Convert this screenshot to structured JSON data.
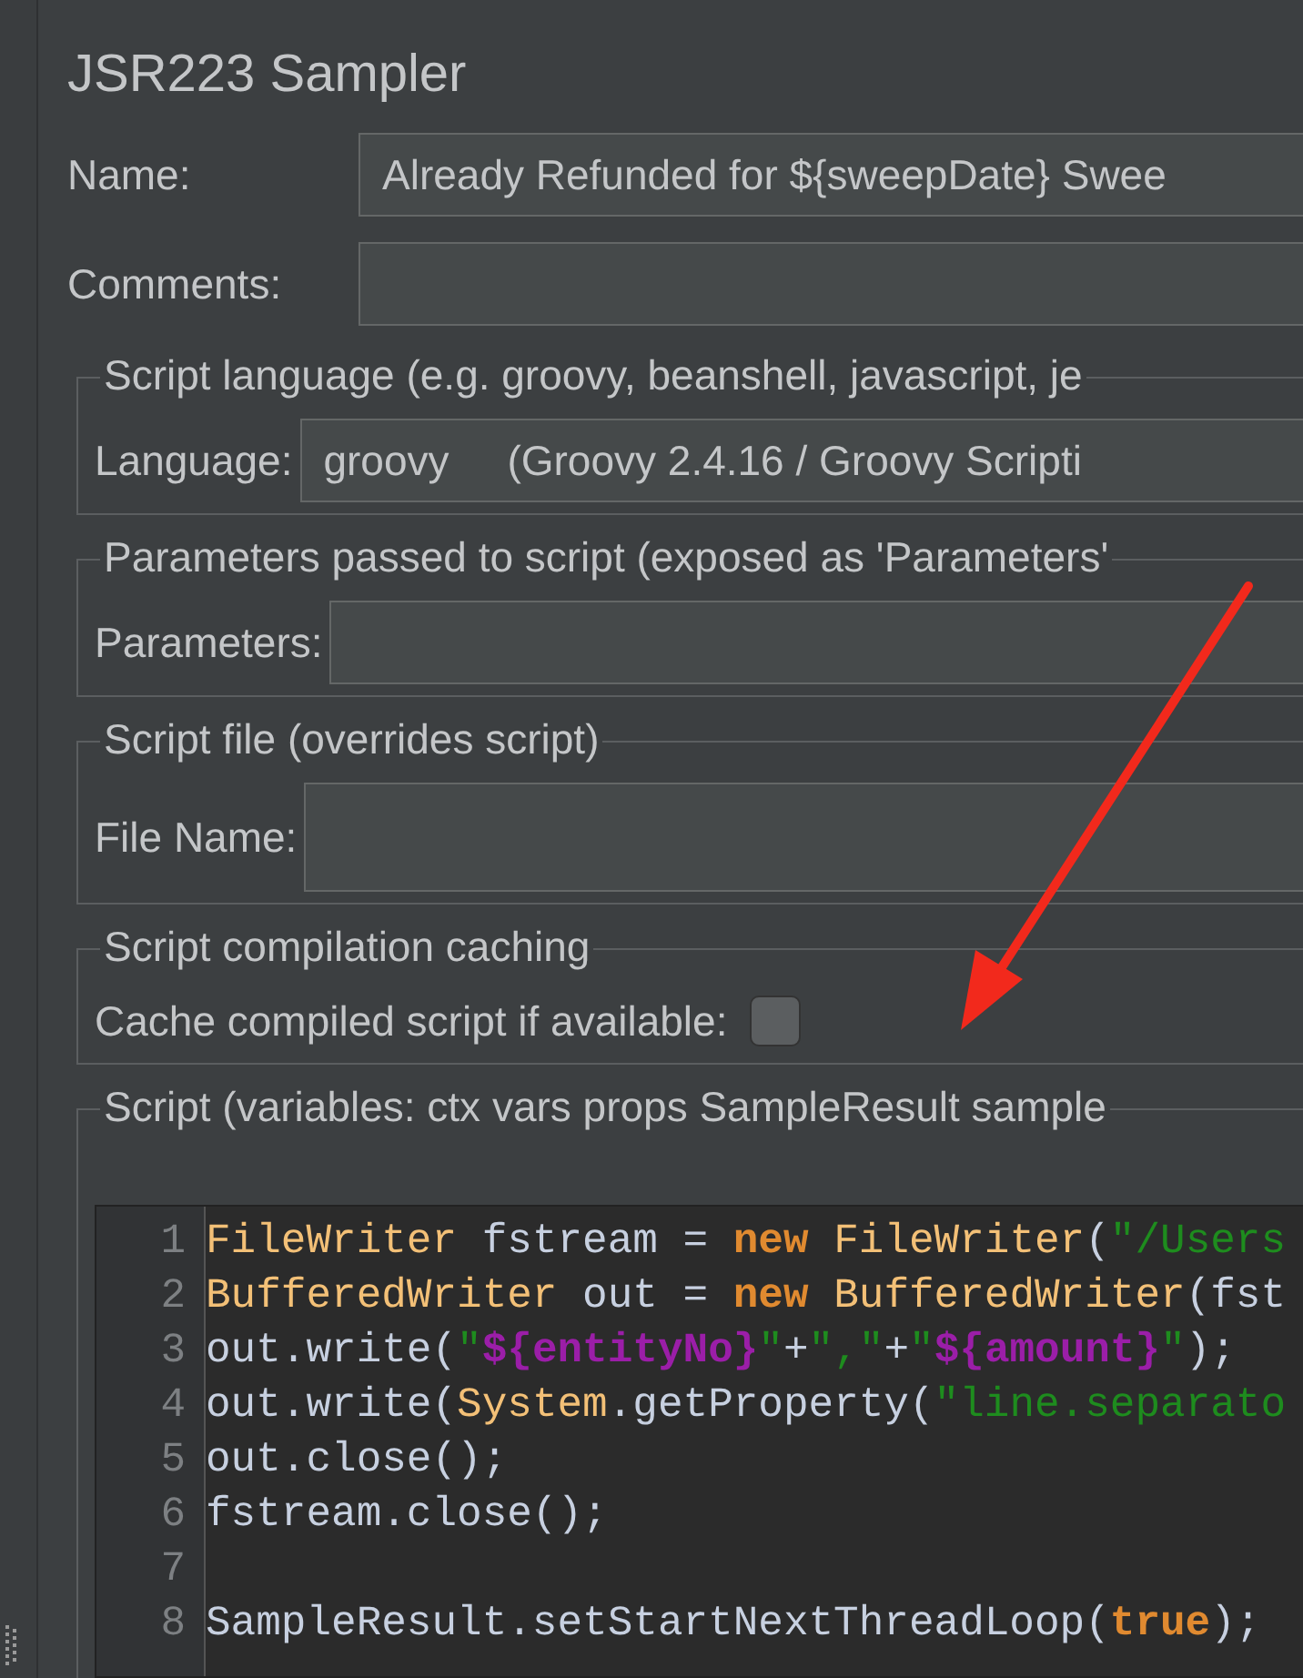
{
  "title": "JSR223 Sampler",
  "name_field": {
    "label": "Name:",
    "value": "Already Refunded for ${sweepDate} Swee"
  },
  "comments_field": {
    "label": "Comments:"
  },
  "groups": [
    {
      "kind": "combo",
      "legend": "Script language (e.g. groovy, beanshell, javascript, je",
      "label": "Language:",
      "value": "groovy     (Groovy 2.4.16 / Groovy Scripti"
    },
    {
      "kind": "field",
      "legend": "Parameters passed to script (exposed as 'Parameters'",
      "label": "Parameters:"
    },
    {
      "kind": "tallfield",
      "legend": "Script file (overrides script)",
      "label": "File Name:"
    },
    {
      "kind": "checkbox",
      "legend": "Script compilation caching",
      "label": "Cache compiled script if available:",
      "checked": false
    },
    {
      "kind": "editor",
      "legend": "Script (variables: ctx vars props SampleResult sample",
      "lines": [
        {
          "number": "1",
          "tokens": [
            {
              "kind": "type",
              "text": "FileWriter"
            },
            {
              "kind": "plain",
              "text": " fstream = "
            },
            {
              "kind": "keyword",
              "text": "new"
            },
            {
              "kind": "type",
              "text": " FileWriter"
            },
            {
              "kind": "plain",
              "text": "("
            },
            {
              "kind": "string",
              "text": "\"/Users"
            }
          ]
        },
        {
          "number": "2",
          "tokens": [
            {
              "kind": "type",
              "text": "BufferedWriter"
            },
            {
              "kind": "plain",
              "text": " out = "
            },
            {
              "kind": "keyword",
              "text": "new"
            },
            {
              "kind": "type",
              "text": " BufferedWriter"
            },
            {
              "kind": "plain",
              "text": "(fst"
            }
          ]
        },
        {
          "number": "3",
          "tokens": [
            {
              "kind": "plain",
              "text": "out.write("
            },
            {
              "kind": "string",
              "text": "\""
            },
            {
              "kind": "variable",
              "text": "${entityNo}"
            },
            {
              "kind": "string",
              "text": "\""
            },
            {
              "kind": "plain",
              "text": "+"
            },
            {
              "kind": "string",
              "text": "\",\""
            },
            {
              "kind": "plain",
              "text": "+"
            },
            {
              "kind": "string",
              "text": "\""
            },
            {
              "kind": "variable",
              "text": "${amount}"
            },
            {
              "kind": "string",
              "text": "\""
            },
            {
              "kind": "plain",
              "text": ");"
            }
          ]
        },
        {
          "number": "4",
          "tokens": [
            {
              "kind": "plain",
              "text": "out.write("
            },
            {
              "kind": "type",
              "text": "System"
            },
            {
              "kind": "plain",
              "text": ".getProperty("
            },
            {
              "kind": "string",
              "text": "\"line.separato"
            }
          ]
        },
        {
          "number": "5",
          "tokens": [
            {
              "kind": "plain",
              "text": "out.close();"
            }
          ]
        },
        {
          "number": "6",
          "tokens": [
            {
              "kind": "plain",
              "text": "fstream.close();"
            }
          ]
        },
        {
          "number": "7"
        },
        {
          "number": "8",
          "tokens": [
            {
              "kind": "plain",
              "text": "SampleResult.setStartNextThreadLoop("
            },
            {
              "kind": "keyword",
              "text": "true"
            },
            {
              "kind": "plain",
              "text": ");"
            }
          ]
        }
      ]
    }
  ]
}
